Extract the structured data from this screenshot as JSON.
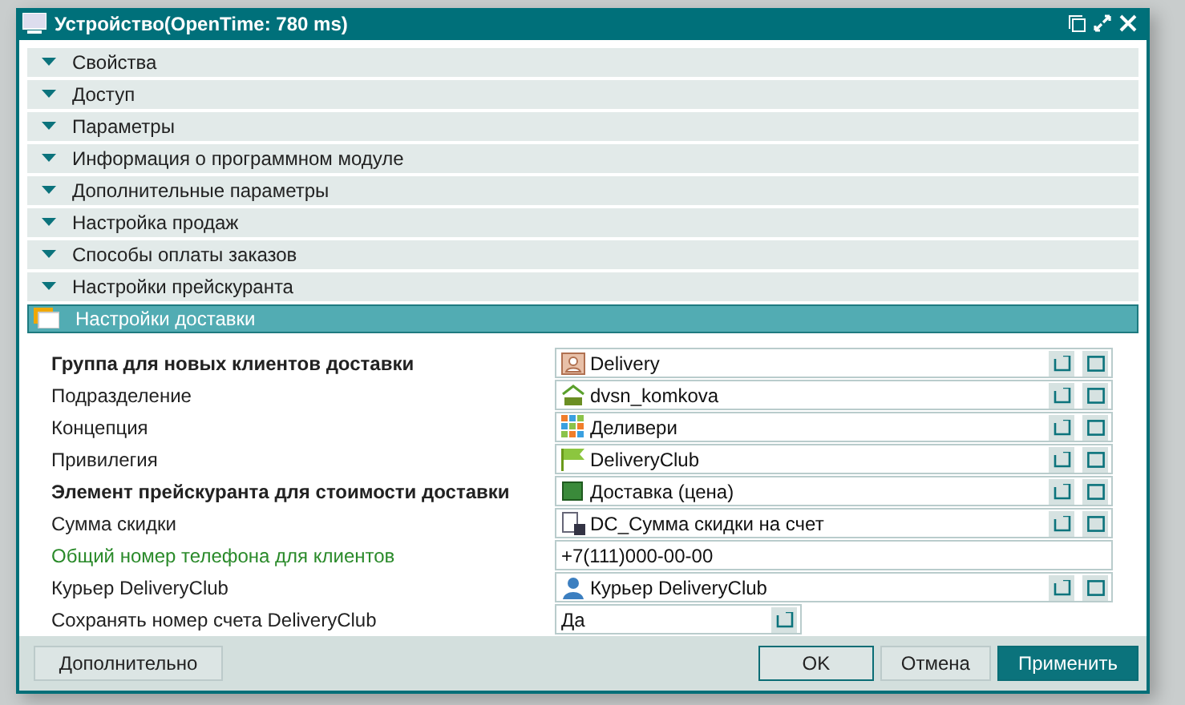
{
  "window": {
    "title": "Устройство(OpenTime: 780 ms)"
  },
  "sections": [
    {
      "label": "Свойства",
      "selected": false
    },
    {
      "label": "Доступ",
      "selected": false
    },
    {
      "label": "Параметры",
      "selected": false
    },
    {
      "label": "Информация о программном модуле",
      "selected": false
    },
    {
      "label": "Дополнительные параметры",
      "selected": false
    },
    {
      "label": "Настройка продаж",
      "selected": false
    },
    {
      "label": "Способы оплаты заказов",
      "selected": false
    },
    {
      "label": "Настройки прейскуранта",
      "selected": false
    },
    {
      "label": "Настройки доставки",
      "selected": true
    }
  ],
  "fields": [
    {
      "label": "Группа для новых клиентов доставки",
      "bold": true,
      "highlighted": false,
      "kind": "reference",
      "value": "Delivery"
    },
    {
      "label": "Подразделение",
      "bold": false,
      "highlighted": false,
      "kind": "reference",
      "value": "dvsn_komkova"
    },
    {
      "label": "Концепция",
      "bold": false,
      "highlighted": false,
      "kind": "reference",
      "value": "Деливери"
    },
    {
      "label": "Привилегия",
      "bold": false,
      "highlighted": false,
      "kind": "reference",
      "value": "DeliveryClub"
    },
    {
      "label": "Элемент прейскуранта для стоимости доставки",
      "bold": true,
      "highlighted": false,
      "kind": "reference",
      "value": "Доставка (цена)"
    },
    {
      "label": "Сумма скидки",
      "bold": false,
      "highlighted": false,
      "kind": "reference",
      "value": "DC_Сумма скидки на счет"
    },
    {
      "label": "Общий номер телефона для клиентов",
      "bold": false,
      "highlighted": true,
      "kind": "text",
      "value": "+7(111)000-00-00"
    },
    {
      "label": "Курьер DeliveryClub",
      "bold": false,
      "highlighted": false,
      "kind": "reference",
      "value": "Курьер DeliveryClub"
    },
    {
      "label": "Сохранять номер счета DeliveryClub",
      "bold": false,
      "highlighted": false,
      "kind": "choice",
      "value": "Да"
    }
  ],
  "footer": {
    "more": "Дополнительно",
    "buttons": [
      {
        "label": "OK",
        "kind": "outline"
      },
      {
        "label": "Отмена",
        "kind": "plain"
      },
      {
        "label": "Применить",
        "kind": "primary"
      }
    ]
  }
}
